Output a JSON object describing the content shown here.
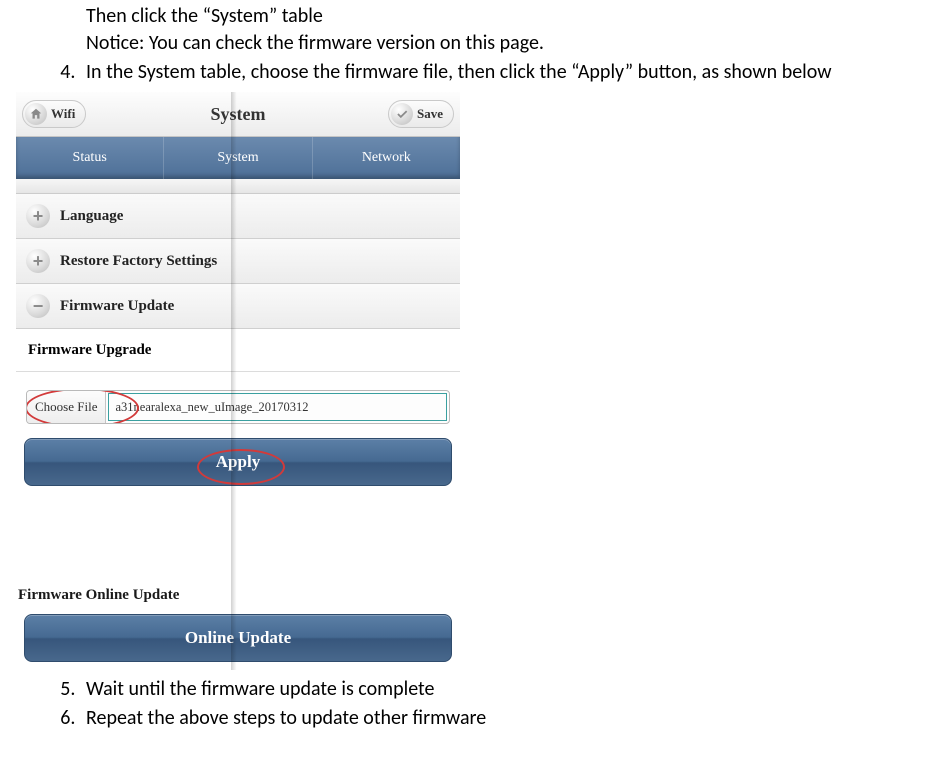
{
  "doc": {
    "line_a": "Then click the “System” table",
    "line_b": "Notice: You can check the firmware version on this page.",
    "step4": "In the System table, choose the firmware file, then click the “Apply” button, as shown below",
    "step5": "Wait until the firmware update is complete",
    "step6": "Repeat the above steps to update other firmware"
  },
  "app": {
    "header": {
      "wifi": "Wifi",
      "title": "System",
      "save": "Save"
    },
    "tabs": {
      "status": "Status",
      "system": "System",
      "network": "Network"
    },
    "acc": {
      "language": "Language",
      "restore": "Restore Factory Settings",
      "firmware_update": "Firmware Update"
    },
    "sections": {
      "firmware_upgrade": "Firmware Upgrade",
      "online_update": "Firmware Online Update"
    },
    "file": {
      "choose_label": "Choose File",
      "name": "a31nearalexa_new_uImage_20170312"
    },
    "buttons": {
      "apply": "Apply",
      "online_update": "Online Update"
    }
  }
}
